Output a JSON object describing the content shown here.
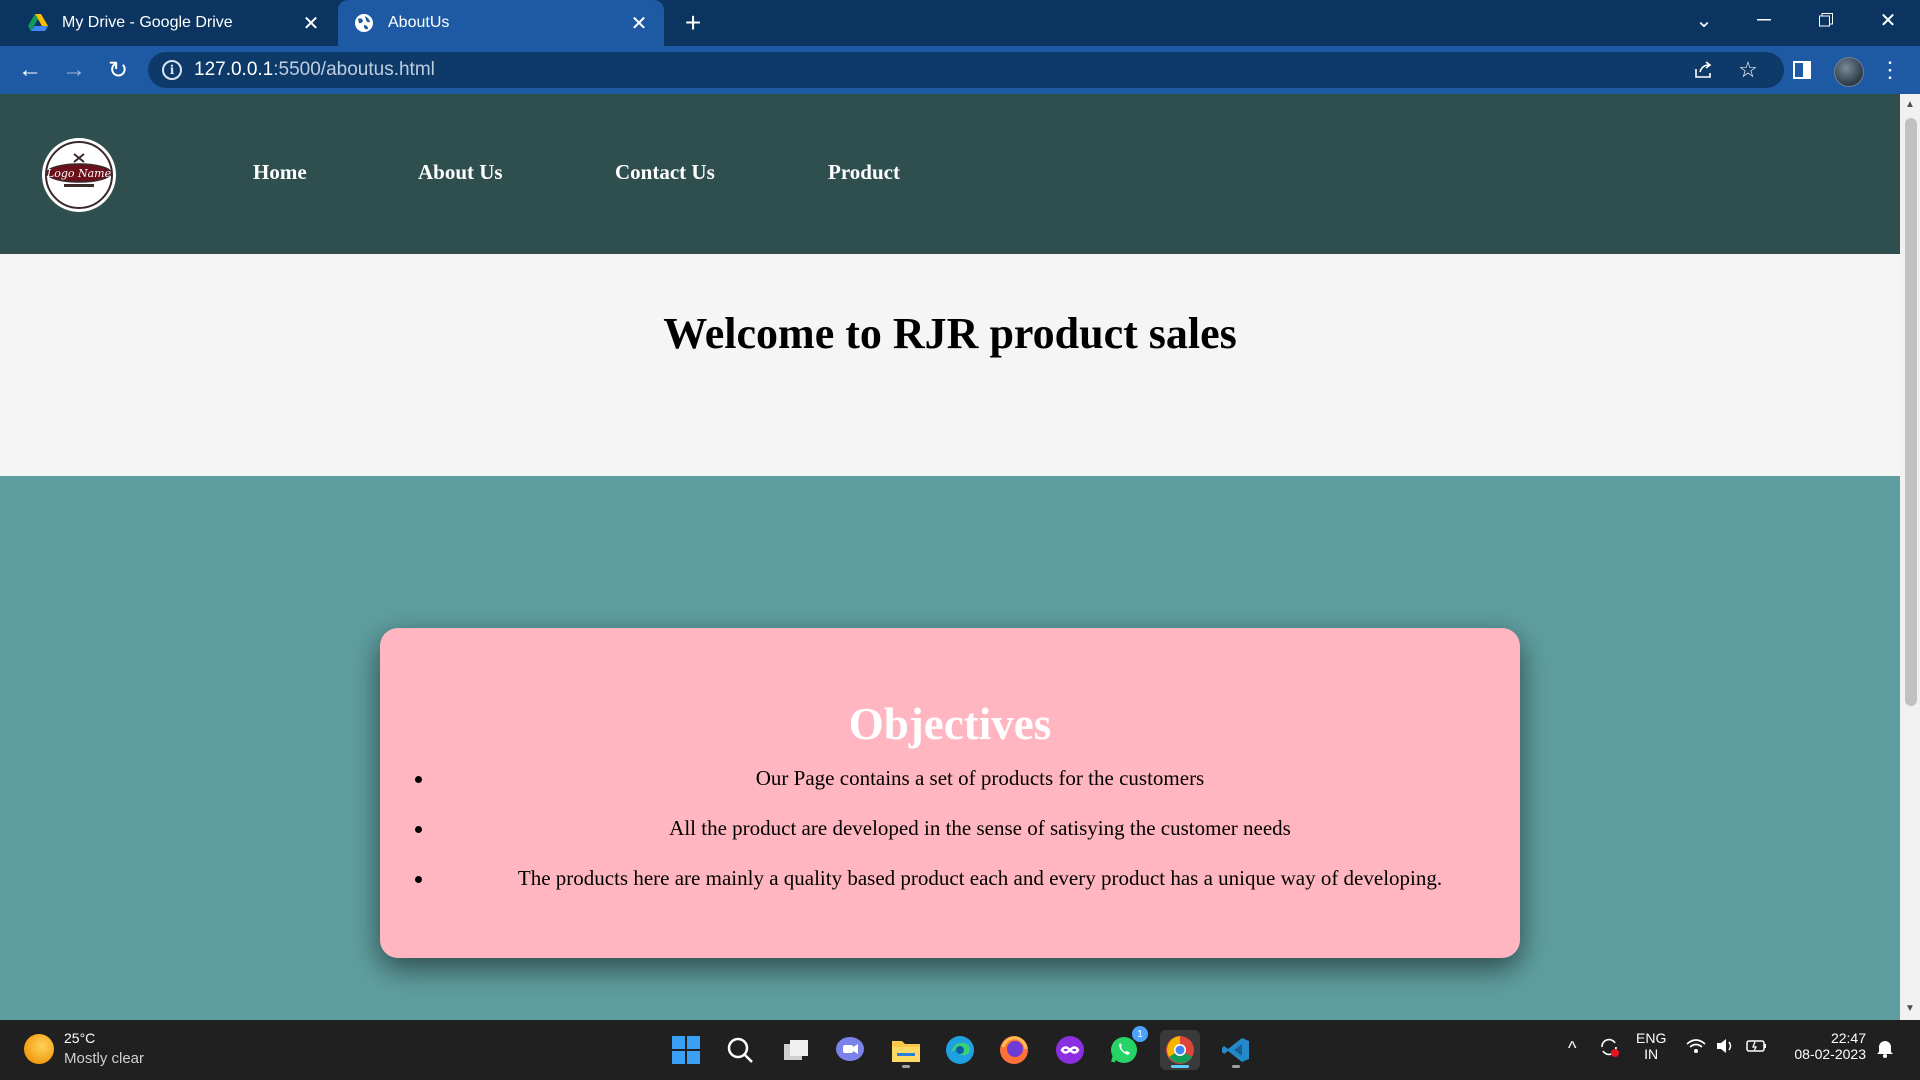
{
  "browser": {
    "tabs": [
      {
        "title": "My Drive - Google Drive",
        "favicon": "google-drive-icon",
        "active": false
      },
      {
        "title": "AboutUs",
        "favicon": "globe-icon",
        "active": true
      }
    ],
    "new_tab_label": "+",
    "url": {
      "host": "127.0.0.1",
      "rest": ":5500/aboutus.html"
    }
  },
  "site": {
    "logo_text": "Logo Name",
    "nav": [
      "Home",
      "About Us",
      "Contact Us",
      "Product"
    ],
    "welcome_title": "Welcome to RJR product sales",
    "objectives": {
      "title": "Objectives",
      "items": [
        "Our Page contains a set of products for the customers",
        "All the product are developed in the sense of satisying the customer needs",
        "The products here are mainly a quality based product each and every product has a unique way of developing."
      ]
    },
    "colors": {
      "header_bg": "#2f4f4f",
      "welcome_bg": "#f5f5f5",
      "body_bg": "#5f9ea0",
      "card_bg": "#ffb6c1"
    }
  },
  "taskbar": {
    "weather": {
      "temp": "25°C",
      "desc": "Mostly clear"
    },
    "language": {
      "lang": "ENG",
      "region": "IN"
    },
    "clock": {
      "time": "22:47",
      "date": "08-02-2023"
    },
    "whatsapp_badge": "1",
    "apps": [
      "windows-start-icon",
      "search-icon",
      "task-view-icon",
      "teams-chat-icon",
      "file-explorer-icon",
      "edge-icon",
      "firefox-icon",
      "game-icon",
      "whatsapp-icon",
      "chrome-icon",
      "vscode-icon"
    ]
  }
}
